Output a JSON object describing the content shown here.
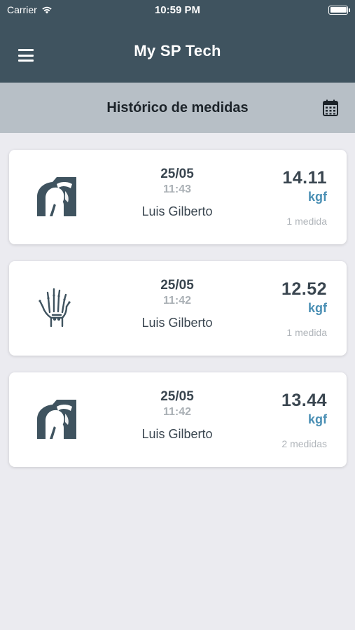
{
  "status": {
    "carrier": "Carrier",
    "time": "10:59 PM",
    "battery_level": 1.0
  },
  "nav": {
    "title": "My SP Tech",
    "menu_icon": "hamburger-menu-icon"
  },
  "section": {
    "title": "Histórico de medidas",
    "calendar_icon": "calendar-icon"
  },
  "colors": {
    "header_bg": "#3f535f",
    "subheader_bg": "#b7bfc6",
    "accent_unit": "#4a8fb4",
    "page_bg": "#ebebf0"
  },
  "measurements": [
    {
      "icon": "shoulder-icon",
      "date": "25/05",
      "time": "11:43",
      "name": "Luis Gilberto",
      "value": "14.11",
      "unit": "kgf",
      "count": "1 medida"
    },
    {
      "icon": "hand-icon",
      "date": "25/05",
      "time": "11:42",
      "name": "Luis Gilberto",
      "value": "12.52",
      "unit": "kgf",
      "count": "1 medida"
    },
    {
      "icon": "shoulder-icon",
      "date": "25/05",
      "time": "11:42",
      "name": "Luis Gilberto",
      "value": "13.44",
      "unit": "kgf",
      "count": "2 medidas"
    }
  ]
}
